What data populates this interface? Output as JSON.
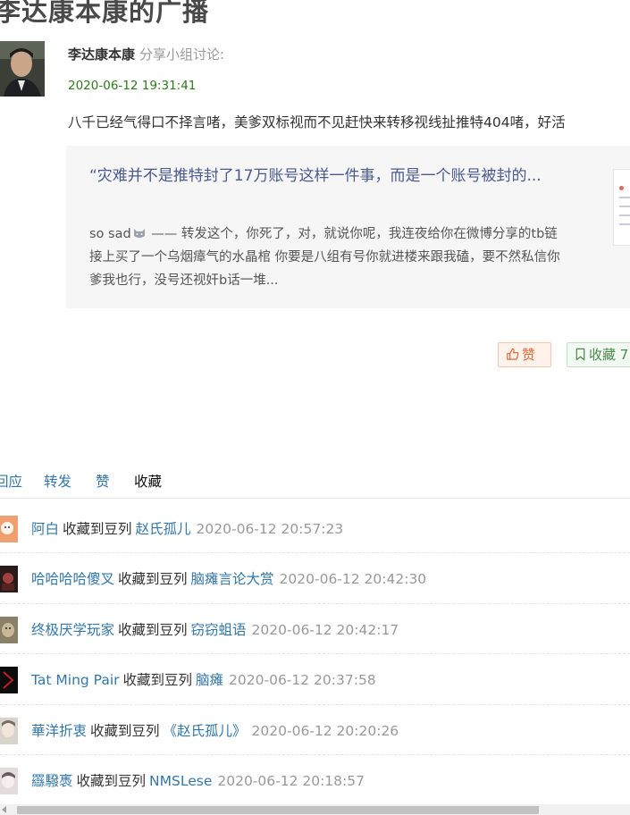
{
  "page": {
    "title": "李达康本康的广播"
  },
  "status": {
    "author": "李达康本康",
    "action": "分享小组讨论:",
    "time": "2020-06-12 19:31:41",
    "text": "八千已经气得口不择言啫，美爹双标视而不见赶快来转移视线扯推特404啫，好活"
  },
  "shared_card": {
    "title": "“灾难并不是推特封了17万账号这样一件事，而是一个账号被封的...",
    "desc_before_emoji": "so sad",
    "desc_after_emoji": " —— 转发这个，你死了，对，就说你呢，我连夜给你在微博分享的tb链接上买了一个乌烟瘴气的水晶棺 你要是八组有号你就进楼来跟我磕，要不然私信你爹我也行，没号还视奸b话一堆..."
  },
  "actions": {
    "like_label": "赞",
    "collect_label": "收藏 7"
  },
  "tabs": [
    {
      "label": "回应"
    },
    {
      "label": "转发"
    },
    {
      "label": "赞"
    },
    {
      "label": "收藏"
    }
  ],
  "collect_rows": [
    {
      "user": "阿白",
      "verb": "收藏到豆列",
      "doulist": "赵氏孤儿",
      "time": "2020-06-12 20:57:23"
    },
    {
      "user": "哈哈哈哈傻叉",
      "verb": "收藏到豆列",
      "doulist": "脑瘫言论大赏",
      "time": "2020-06-12 20:42:30"
    },
    {
      "user": "终极厌学玩家",
      "verb": "收藏到豆列",
      "doulist": "窃窃蛆语",
      "time": "2020-06-12 20:42:17"
    },
    {
      "user": "Tat Ming Pair",
      "verb": "收藏到豆列",
      "doulist": "脑瘫",
      "time": "2020-06-12 20:37:58"
    },
    {
      "user": "華洋折衷",
      "verb": "收藏到豆列",
      "doulist": "《赵氏孤儿》",
      "time": "2020-06-12 20:20:26"
    },
    {
      "user": "羉驋褭",
      "verb": "收藏到豆列",
      "doulist": "NMSLese",
      "time": "2020-06-12 20:18:57"
    }
  ],
  "colors": {
    "link": "#3377aa",
    "time_green": "#2c7a1d",
    "like": "#e06a3a",
    "collect": "#4c8a4c"
  },
  "icons": {
    "like": "thumbs-up-icon",
    "collect": "bookmark-icon",
    "emoji": "cat-face-icon"
  }
}
